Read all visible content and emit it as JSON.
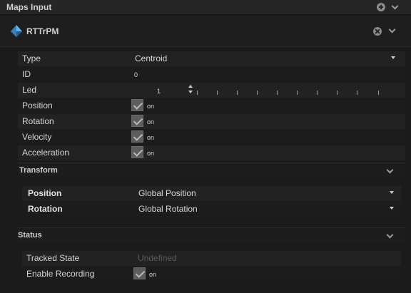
{
  "panel": {
    "title": "Maps Input"
  },
  "device": {
    "name": "RTTrPM"
  },
  "properties": {
    "type": {
      "label": "Type",
      "value": "Centroid"
    },
    "id": {
      "label": "ID",
      "value": "0"
    },
    "led": {
      "label": "Led",
      "value": "1"
    },
    "position": {
      "label": "Position",
      "state": "on"
    },
    "rotation": {
      "label": "Rotation",
      "state": "on"
    },
    "velocity": {
      "label": "Velocity",
      "state": "on"
    },
    "acceleration": {
      "label": "Acceleration",
      "state": "on"
    }
  },
  "transform": {
    "title": "Transform",
    "position": {
      "label": "Position",
      "value": "Global Position"
    },
    "rotation": {
      "label": "Rotation",
      "value": "Global Rotation"
    }
  },
  "status": {
    "title": "Status",
    "tracked_state": {
      "label": "Tracked State",
      "value": "Undefined"
    },
    "enable_recording": {
      "label": "Enable Recording",
      "state": "on"
    }
  },
  "icons": {
    "device": "rttrpm-device-icon",
    "add": "plus-circle-icon",
    "close": "close-circle-icon",
    "collapse": "chevron-down-icon"
  }
}
